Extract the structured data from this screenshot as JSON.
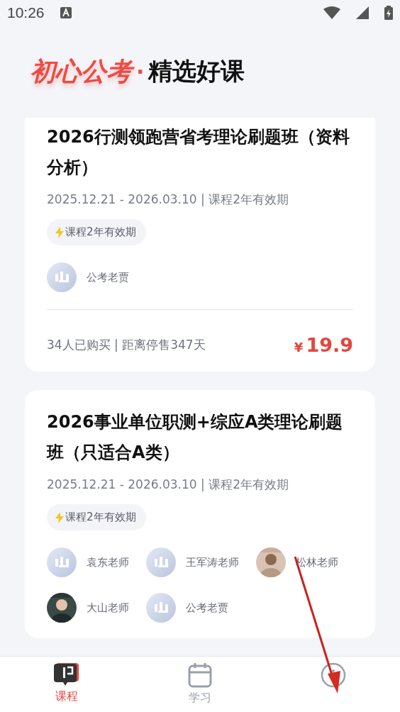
{
  "status_bar": {
    "time": "10:26"
  },
  "header": {
    "brand": "初心公考",
    "separator": "·",
    "title": "精选好课"
  },
  "courses": [
    {
      "title": "2026行测领跑营省考理论刷题班（资料分析）",
      "period": "2025.12.21 - 2026.03.10 | 课程2年有效期",
      "tag": "课程2年有效期",
      "teachers": [
        {
          "name": "公考老贾",
          "kind": "logo"
        }
      ],
      "sales": "34人已购买 | 距离停售347天",
      "currency": "¥",
      "price": "19.9"
    },
    {
      "title": "2026事业单位职测+综应A类理论刷题班（只适合A类）",
      "period": "2025.12.21 - 2026.03.10 | 课程2年有效期",
      "tag": "课程2年有效期",
      "teachers": [
        {
          "name": "袁东老师",
          "kind": "logo"
        },
        {
          "name": "王军涛老师",
          "kind": "logo"
        },
        {
          "name": "松林老师",
          "kind": "picture"
        },
        {
          "name": "大山老师",
          "kind": "picture"
        },
        {
          "name": "公考老贾",
          "kind": "logo"
        }
      ]
    }
  ],
  "nav": [
    {
      "label": "课程",
      "kind": "book",
      "selected": true
    },
    {
      "label": "学习",
      "kind": "calendar",
      "selected": false
    },
    {
      "kind": "profile",
      "selected": false
    }
  ]
}
